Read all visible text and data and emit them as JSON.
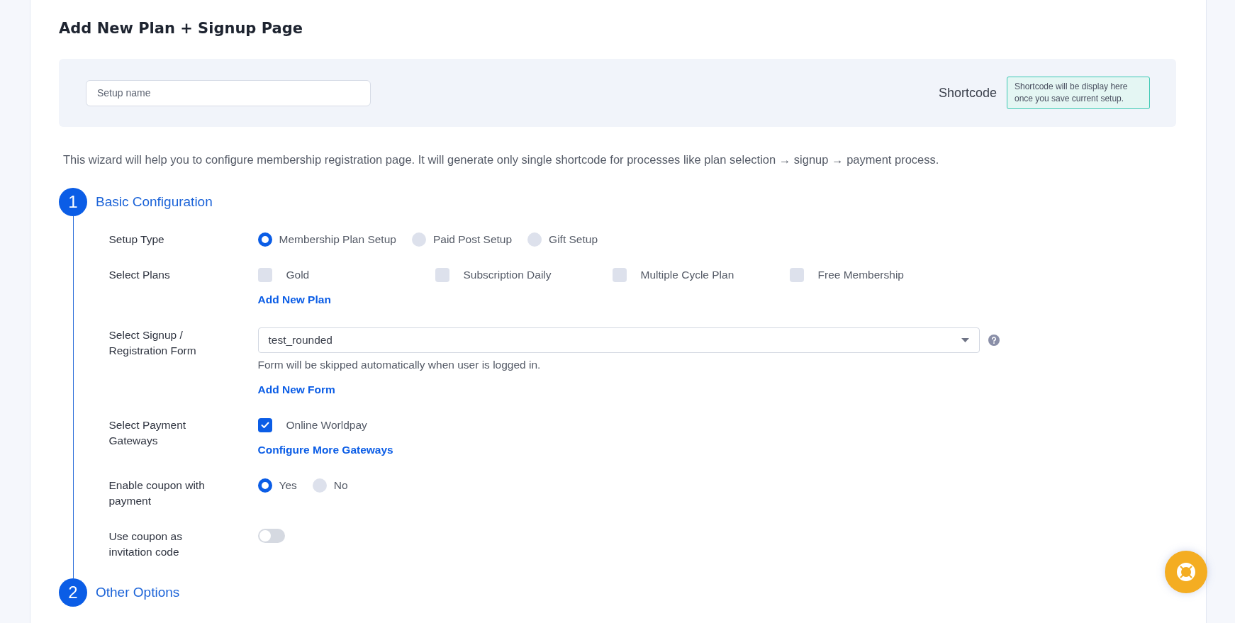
{
  "page_title": "Add New Plan + Signup Page",
  "setup": {
    "name_field": {
      "placeholder": "Setup name"
    },
    "shortcode_label": "Shortcode",
    "shortcode_note": "Shortcode will be display here once you save current setup."
  },
  "description": "This wizard will help you to configure membership registration page. It will generate only single shortcode for processes like plan selection → signup → payment process.",
  "steps": [
    {
      "number": "1",
      "title": "Basic Configuration",
      "fields": [
        {
          "kind": "radio",
          "label": "Setup Type",
          "options": [
            {
              "label": "Membership Plan Setup",
              "selected": true
            },
            {
              "label": "Paid Post Setup",
              "selected": false
            },
            {
              "label": "Gift Setup",
              "selected": false
            }
          ]
        },
        {
          "kind": "checkbox",
          "label": "Select Plans",
          "options": [
            {
              "label": "Gold",
              "checked": false
            },
            {
              "label": "Subscription Daily",
              "checked": false
            },
            {
              "label": "Multiple Cycle Plan",
              "checked": false
            },
            {
              "label": "Free Membership",
              "checked": false
            }
          ],
          "link": "Add New Plan"
        },
        {
          "kind": "select",
          "label": "Select Signup / Registration Form",
          "value": "test_rounded",
          "hint": "Form will be skipped automatically when user is logged in.",
          "link": "Add New Form"
        },
        {
          "kind": "checkbox",
          "label": "Select Payment Gateways",
          "options": [
            {
              "label": "Online Worldpay",
              "checked": true
            }
          ],
          "link": "Configure More Gateways"
        },
        {
          "kind": "radio",
          "label": "Enable coupon with payment",
          "options": [
            {
              "label": "Yes",
              "selected": true
            },
            {
              "label": "No",
              "selected": false
            }
          ]
        },
        {
          "kind": "toggle",
          "label": "Use coupon as invitation code",
          "on": false
        }
      ]
    },
    {
      "number": "2",
      "title": "Other Options"
    }
  ]
}
